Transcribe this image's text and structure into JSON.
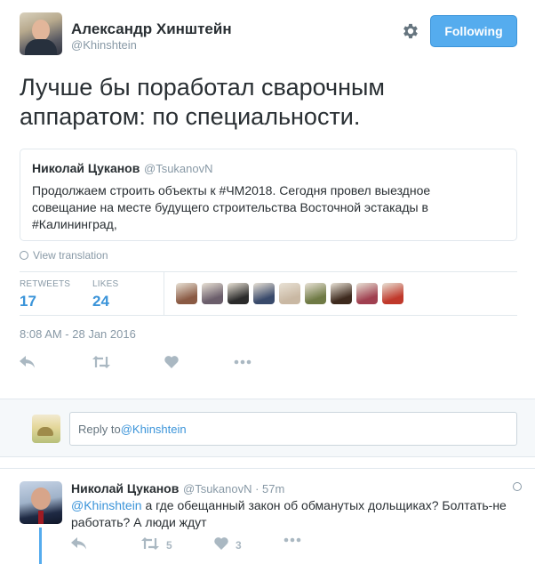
{
  "tweet": {
    "author_name": "Александр Хинштейн",
    "author_handle": "@Khinshtein",
    "follow_label": "Following",
    "text": "Лучше бы поработал сварочным аппаратом: по специальности.",
    "quote": {
      "name": "Николай Цуканов",
      "handle": "@TsukanovN",
      "text": "Продолжаем строить объекты к #ЧМ2018. Сегодня провел выездное совещание на месте будущего строительства Восточной эстакады в #Калининград,"
    },
    "view_translation": "View translation",
    "stats": {
      "retweets_label": "RETWEETS",
      "retweets_value": "17",
      "likes_label": "LIKES",
      "likes_value": "24"
    },
    "timestamp": "8:08 AM - 28 Jan 2016",
    "liker_avatar_colors": [
      "#8a5a44",
      "#6b5e6b",
      "#2b2b2b",
      "#394a6b",
      "#c9b8a3",
      "#6f7a45",
      "#3e2a1e",
      "#a04050",
      "#c0392b"
    ]
  },
  "reply_box": {
    "prefix": "Reply to ",
    "mention": "@Khinshtein"
  },
  "reply_tweet": {
    "name": "Николай Цуканов",
    "handle_time": "@TsukanovN · 57m",
    "mention": "@Khinshtein",
    "text": " а где обещанный закон об обманутых дольщиках? Болтать-не работать? А люди ждут",
    "retweet_count": "5",
    "like_count": "3"
  },
  "colors": {
    "accent": "#55acee",
    "link": "#3b94d9",
    "muted": "#8899a6",
    "icon": "#aab8c2"
  }
}
